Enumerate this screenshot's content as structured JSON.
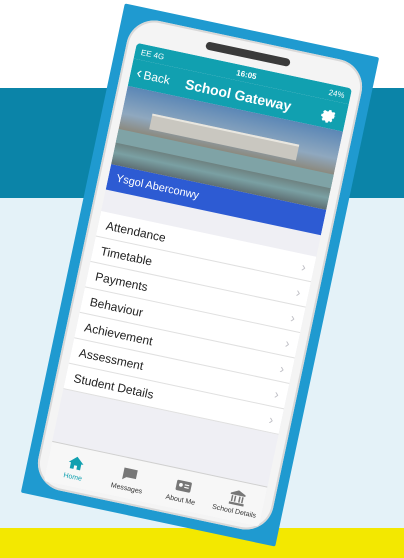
{
  "colors": {
    "accent": "#11a0b0",
    "school_bar": "#2d5bd3",
    "band_blue": "#0b84a8",
    "band_light": "#e4f2f8",
    "band_yellow": "#f3e800",
    "frame": "#1f9ad0"
  },
  "status": {
    "carrier": "EE 4G",
    "time": "16:05",
    "battery": "24%"
  },
  "nav": {
    "back_label": "Back",
    "title": "School Gateway",
    "settings_icon": "gear-icon"
  },
  "school": {
    "name": "Ysgol Aberconwy"
  },
  "menu": {
    "items": [
      {
        "label": "Attendance"
      },
      {
        "label": "Timetable"
      },
      {
        "label": "Payments"
      },
      {
        "label": "Behaviour"
      },
      {
        "label": "Achievement"
      },
      {
        "label": "Assessment"
      },
      {
        "label": "Student Details"
      }
    ]
  },
  "tabs": [
    {
      "label": "Home",
      "icon": "home-icon"
    },
    {
      "label": "Messages",
      "icon": "chat-icon"
    },
    {
      "label": "About Me",
      "icon": "id-card-icon"
    },
    {
      "label": "School Details",
      "icon": "building-icon"
    }
  ]
}
